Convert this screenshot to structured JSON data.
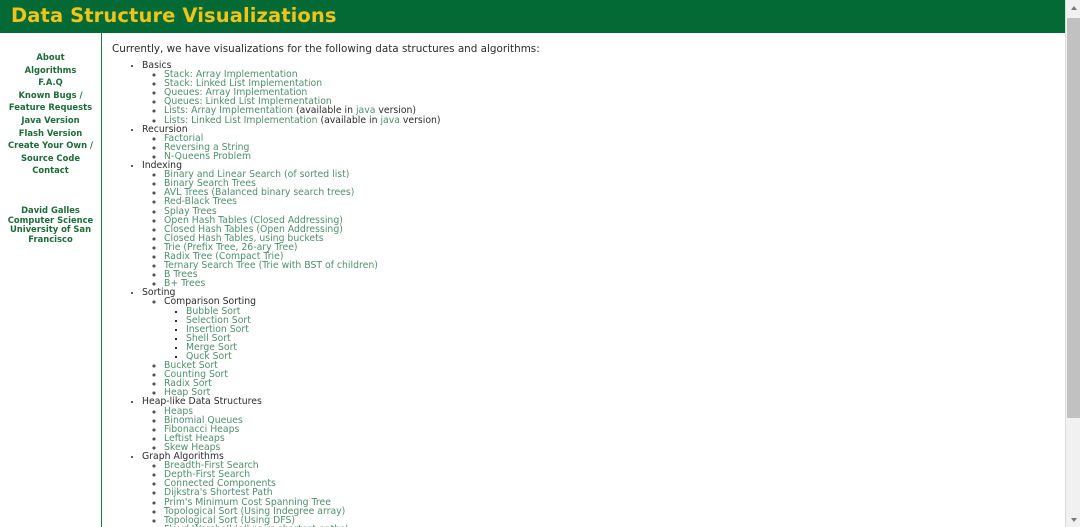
{
  "header": {
    "title": "Data Structure Visualizations"
  },
  "sidebar": {
    "links": [
      {
        "label": "About"
      },
      {
        "label": "Algorithms"
      },
      {
        "label": "F.A.Q"
      },
      {
        "label": "Known Bugs / Feature Requests"
      },
      {
        "label": "Java Version"
      },
      {
        "label": "Flash Version"
      },
      {
        "label": "Create Your Own / Source Code"
      },
      {
        "label": "Contact"
      }
    ],
    "credits": [
      "David Galles",
      "Computer Science",
      "University of San Francisco"
    ]
  },
  "content": {
    "intro": "Currently, we have visualizations for the following data structures and algorithms:",
    "sections": [
      {
        "label": "Basics",
        "items": [
          {
            "text": "Stack: Array Implementation",
            "link": true
          },
          {
            "text": "Stack: Linked List Implementation",
            "link": true
          },
          {
            "text": "Queues: Array Implementation",
            "link": true
          },
          {
            "text": "Queues: Linked List Implementation",
            "link": true
          },
          {
            "text": "Lists: Array Implementation",
            "link": true,
            "suffix_pre": " (available in ",
            "suffix_link": "java",
            "suffix_post": " version)"
          },
          {
            "text": "Lists: Linked List Implementation",
            "link": true,
            "suffix_pre": " (available in ",
            "suffix_link": "java",
            "suffix_post": " version)"
          }
        ]
      },
      {
        "label": "Recursion",
        "items": [
          {
            "text": "Factorial",
            "link": true
          },
          {
            "text": "Reversing a String",
            "link": true
          },
          {
            "text": "N-Queens Problem",
            "link": true
          }
        ]
      },
      {
        "label": "Indexing",
        "items": [
          {
            "text": "Binary and Linear Search (of sorted list)",
            "link": true
          },
          {
            "text": "Binary Search Trees",
            "link": true
          },
          {
            "text": "AVL Trees (Balanced binary search trees)",
            "link": true
          },
          {
            "text": "Red-Black Trees",
            "link": true
          },
          {
            "text": "Splay Trees",
            "link": true
          },
          {
            "text": "Open Hash Tables (Closed Addressing)",
            "link": true
          },
          {
            "text": "Closed Hash Tables (Open Addressing)",
            "link": true
          },
          {
            "text": "Closed Hash Tables, using buckets",
            "link": true
          },
          {
            "text": "Trie (Prefix Tree, 26-ary Tree)",
            "link": true
          },
          {
            "text": "Radix Tree (Compact Trie)",
            "link": true
          },
          {
            "text": "Ternary Search Tree (Trie with BST of children)",
            "link": true
          },
          {
            "text": "B Trees",
            "link": true
          },
          {
            "text": "B+ Trees",
            "link": true
          }
        ]
      },
      {
        "label": "Sorting",
        "items": [
          {
            "text": "Comparison Sorting",
            "link": false,
            "children": [
              {
                "text": "Bubble Sort",
                "link": true
              },
              {
                "text": "Selection Sort",
                "link": true
              },
              {
                "text": "Insertion Sort",
                "link": true
              },
              {
                "text": "Shell Sort",
                "link": true
              },
              {
                "text": "Merge Sort",
                "link": true
              },
              {
                "text": "Quck Sort",
                "link": true
              }
            ]
          },
          {
            "text": "Bucket Sort",
            "link": true
          },
          {
            "text": "Counting Sort",
            "link": true
          },
          {
            "text": "Radix Sort",
            "link": true
          },
          {
            "text": "Heap Sort",
            "link": true
          }
        ]
      },
      {
        "label": "Heap-like Data Structures",
        "items": [
          {
            "text": "Heaps",
            "link": true
          },
          {
            "text": "Binomial Queues",
            "link": true
          },
          {
            "text": "Fibonacci Heaps",
            "link": true
          },
          {
            "text": "Leftist Heaps",
            "link": true
          },
          {
            "text": "Skew Heaps",
            "link": true
          }
        ]
      },
      {
        "label": "Graph Algorithms",
        "items": [
          {
            "text": "Breadth-First Search",
            "link": true
          },
          {
            "text": "Depth-First Search",
            "link": true
          },
          {
            "text": "Connected Components",
            "link": true
          },
          {
            "text": "Dijkstra's Shortest Path",
            "link": true
          },
          {
            "text": "Prim's Minimum Cost Spanning Tree",
            "link": true
          },
          {
            "text": "Topological Sort (Using Indegree array)",
            "link": true
          },
          {
            "text": "Topological Sort (Using DFS)",
            "link": true
          },
          {
            "text": "Floyd-Warshall (all pairs shortest paths)",
            "link": true
          }
        ]
      }
    ]
  },
  "scrollbar": {
    "up_arrow": "▲",
    "down_arrow": "▼"
  },
  "colors": {
    "header_green": "#046a35",
    "header_text": "#f0c419",
    "sidebar_link": "#1e6b3a",
    "content_link": "#4f8f6d",
    "body_text": "#2b2b2b"
  }
}
